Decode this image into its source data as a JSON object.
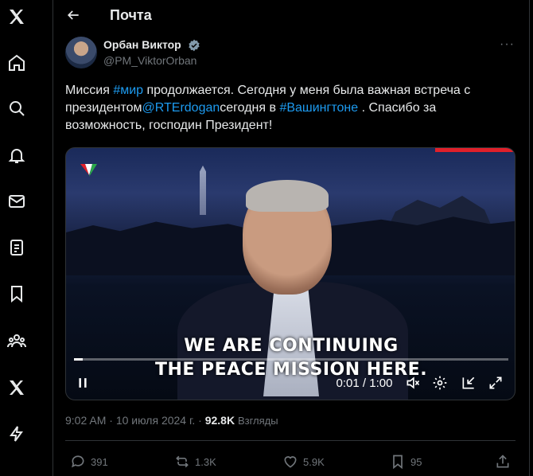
{
  "header": {
    "title": "Почта"
  },
  "nav": {
    "items": [
      "x-logo-icon",
      "home-icon",
      "search-icon",
      "notifications-icon",
      "messages-icon",
      "lists-icon",
      "bookmarks-icon",
      "communities-icon",
      "premium-x-icon",
      "verified-orgs-icon"
    ]
  },
  "tweet": {
    "author_name": "Орбан Виктор",
    "author_handle": "@PM_ViktorOrban",
    "text_part1": "Миссия ",
    "hashtag1": "#мир",
    "text_part2": " продолжается. Сегодня у меня была важная встреча с президентом",
    "mention": "@RTErdogan",
    "text_part3": "сегодня в ",
    "hashtag2": "#Вашингтоне",
    "text_part4": " . Спасибо за возможность, господин Президент!",
    "video": {
      "caption_line1": "WE ARE CONTINUING",
      "caption_line2": "THE PEACE MISSION HERE.",
      "time": "0:01 / 1:00",
      "progress": 0.02
    },
    "meta": {
      "time": "9:02 AM",
      "separator": "·",
      "date": "10 июля 2024 г.",
      "views_count": "92.8K",
      "views_label": "Взгляды"
    },
    "actions": {
      "replies": "391",
      "retweets": "1.3K",
      "likes": "5.9K",
      "bookmarks": "95"
    }
  },
  "colors": {
    "accent": "#1d9bf0",
    "muted": "#71767b",
    "text": "#e7e9ea",
    "background": "#000000"
  }
}
